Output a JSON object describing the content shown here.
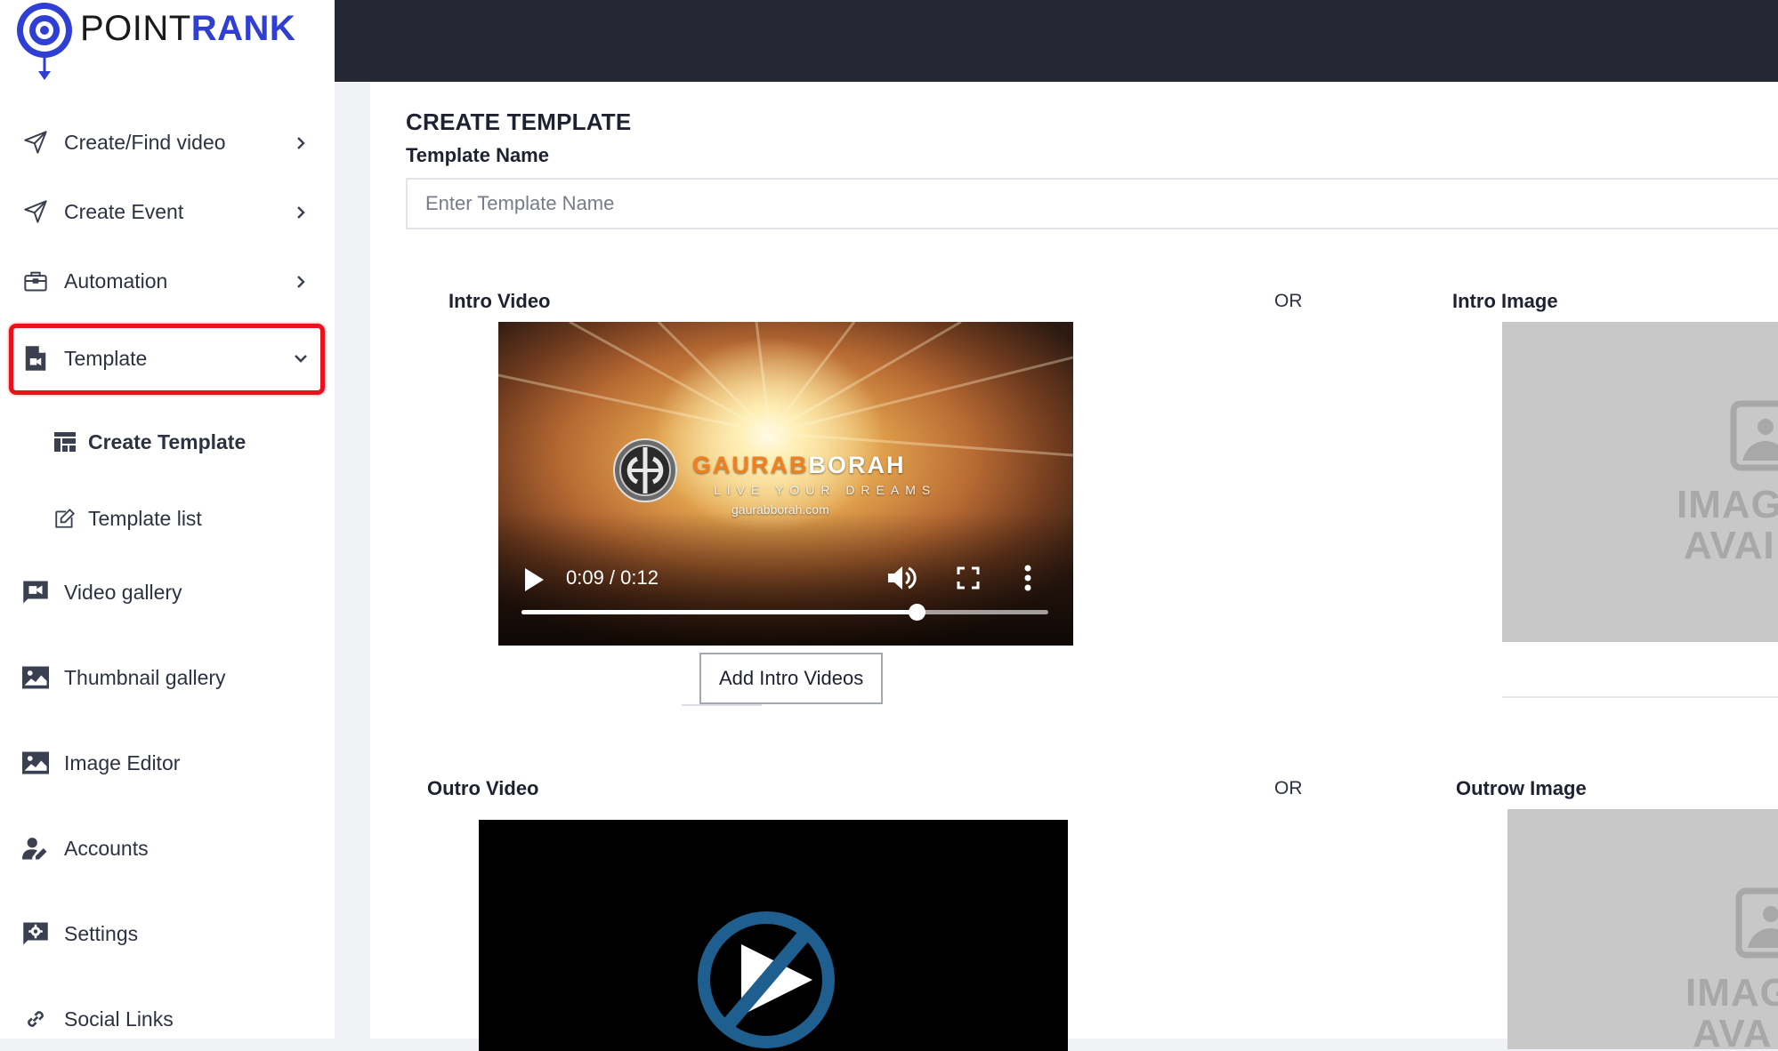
{
  "brand": {
    "name_part1": "POINT",
    "name_part2": "RANK",
    "primary_color": "#2f3ed3"
  },
  "sidebar": {
    "items": [
      {
        "label": "Create/Find video",
        "icon": "send-icon",
        "expanded": false
      },
      {
        "label": "Create Event",
        "icon": "send-icon",
        "expanded": false
      },
      {
        "label": "Automation",
        "icon": "briefcase-icon",
        "expanded": false
      },
      {
        "label": "Template",
        "icon": "file-video-icon",
        "expanded": true
      },
      {
        "label": "Video gallery",
        "icon": "video-camera-icon"
      },
      {
        "label": "Thumbnail gallery",
        "icon": "image-icon"
      },
      {
        "label": "Image Editor",
        "icon": "image-icon"
      },
      {
        "label": "Accounts",
        "icon": "user-edit-icon"
      },
      {
        "label": "Settings",
        "icon": "settings-icon"
      },
      {
        "label": "Social Links",
        "icon": "link-icon"
      }
    ],
    "sub_items": [
      {
        "label": "Create Template",
        "icon": "dashboard-icon",
        "active": true
      },
      {
        "label": "Template list",
        "icon": "edit-icon",
        "active": false
      }
    ],
    "highlight_color": "#e8121b"
  },
  "page": {
    "title": "CREATE TEMPLATE",
    "template_name_label": "Template Name",
    "template_name_placeholder": "Enter Template Name",
    "template_name_value": "",
    "or_label": "OR",
    "intro": {
      "video_label": "Intro Video",
      "image_label": "Intro Image",
      "add_button": "Add Intro Videos",
      "video": {
        "brand_title_part1": "GAURAB",
        "brand_title_part2": "BORAH",
        "tagline": "LIVE YOUR DREAMS",
        "url": "gaurabborah.com",
        "time": "0:09 / 0:12",
        "progress": 0.75
      },
      "image_text_line1": "IMAG",
      "image_text_line2": "AVAI"
    },
    "outro": {
      "video_label": "Outro Video",
      "image_label": "Outrow Image",
      "image_text_line1": "IMAG",
      "image_text_line2": "AVA"
    }
  }
}
